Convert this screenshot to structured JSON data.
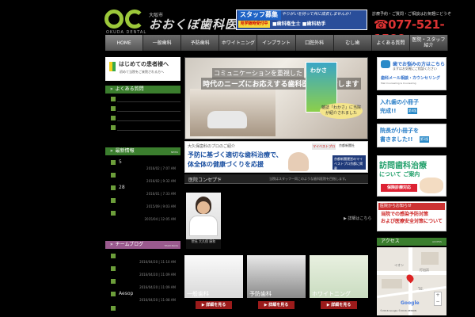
{
  "header": {
    "logo_caption": "OKUDA DENTAL",
    "clinic_sub": "大阪市",
    "clinic_name": "おおくぼ歯科医院",
    "recruit_title": "スタッフ募集",
    "recruit_copy": "やりがいを持って共に成長しませんか！",
    "recruit_tag": "見学随時受付中",
    "recruit_jobs": "■歯科衛生士 ■歯科助手",
    "tel_note": "診療予約・ご質問・ご相談はお気軽にどうぞ",
    "tel": "☎077-521-1500"
  },
  "nav": [
    {
      "label": "HOME"
    },
    {
      "label": "一般歯科"
    },
    {
      "label": "予防歯科"
    },
    {
      "label": "ホワイトニング"
    },
    {
      "label": "インプラント"
    },
    {
      "label": "口腔外科"
    },
    {
      "label": "むし歯"
    },
    {
      "label": "よくある質問"
    },
    {
      "label": "医院・スタッフ紹介"
    }
  ],
  "sidebar_left": {
    "first_title": "はじめての患者様へ",
    "first_sub": "初めて当院をご来院される方へ",
    "faq_title": "よくある質問",
    "faq_items": [
      "",
      "",
      "",
      ""
    ],
    "news_title": "最新情報",
    "news_en": "NEWS",
    "news_items": [
      {
        "label": "5",
        "date": "2016/02 | 7:07 AM"
      },
      {
        "label": "",
        "date": "2016/02 | 9:32 AM"
      },
      {
        "label": "28",
        "date": "2016/01 | 7:33 AM"
      },
      {
        "label": "",
        "date": "2015/09 | 9:03 AM"
      },
      {
        "label": "",
        "date": "2015/04 | 12:05 AM"
      }
    ],
    "blog_title": "チームブログ",
    "blog_en": "TEAM BLOG",
    "blog_items": [
      {
        "label": "",
        "date": "2016/04/20 | 11:10 AM"
      },
      {
        "label": "",
        "date": "2016/04/20 | 11:09 AM"
      },
      {
        "label": "",
        "date": "2016/04/20 | 11:09 AM"
      },
      {
        "label": "Aesop",
        "date": "2016/04/20 | 11:08 AM"
      },
      {
        "label": "",
        "date": ""
      }
    ]
  },
  "hero": {
    "caption1": "コミュニケーションを重視した",
    "caption2": "時代のニーズにお応えする歯科医院を目指します",
    "book_title": "わかさ",
    "book_badge": "雑誌「わかさ」に当院が紹介されました"
  },
  "banner": {
    "tag": "大久保歯科のプロのご紹介",
    "headline1": "予防に基づく適切な歯科治療で、",
    "headline2": "体全体の健康づくりを応援",
    "logo_text": "マイベストプロ",
    "news_text": "京都新聞社",
    "right_text": "京都新聞運営のマイベストプロ京都に掲載"
  },
  "concept": {
    "title": "医院コンセプト",
    "en": "Concept",
    "note": "当院はスタッフ一同このような歯科医院を目指します。",
    "doctor_label": "院長 大久保 康和",
    "more": "▶ 詳細はこちら"
  },
  "tiles": [
    {
      "label": "一般歯科",
      "button": "▶ 詳細を見る"
    },
    {
      "label": "予防歯科",
      "button": "▶ 詳細を見る"
    },
    {
      "label": "ホワイトニング",
      "button": "▶ 詳細を見る"
    }
  ],
  "sidebar_right": {
    "worry_t1": "歯でお悩みの方はこちら",
    "worry_t2": "まずはお気軽にご相談ください",
    "worry_t3": "歯科メール相談・カウンセリング",
    "worry_t4": "Mail Counseling & Counseling",
    "pamph1": "入れ歯の小冊子",
    "pamph1_b": "完成!!",
    "pamph1_tag": "第4版",
    "pamph2": "院長が小冊子を",
    "pamph2_b": "書きました!!",
    "pamph2_tag": "第1版",
    "visit_t1": "訪問歯科治療",
    "visit_t2": "について ご案内",
    "visit_tag": "保険診療対応",
    "alert_head": "医院からお知らせ",
    "alert_t1": "当院での感染予防対策",
    "alert_t2": "および医療安全対策について",
    "access_title": "アクセス",
    "access_en": "ACCESS",
    "map_label1": "イオン",
    "map_label2": "打出浜",
    "map_label3": "T.E.",
    "map_google": "Google",
    "map_copy": "©2016 Google ©2016 ZENRIN"
  }
}
